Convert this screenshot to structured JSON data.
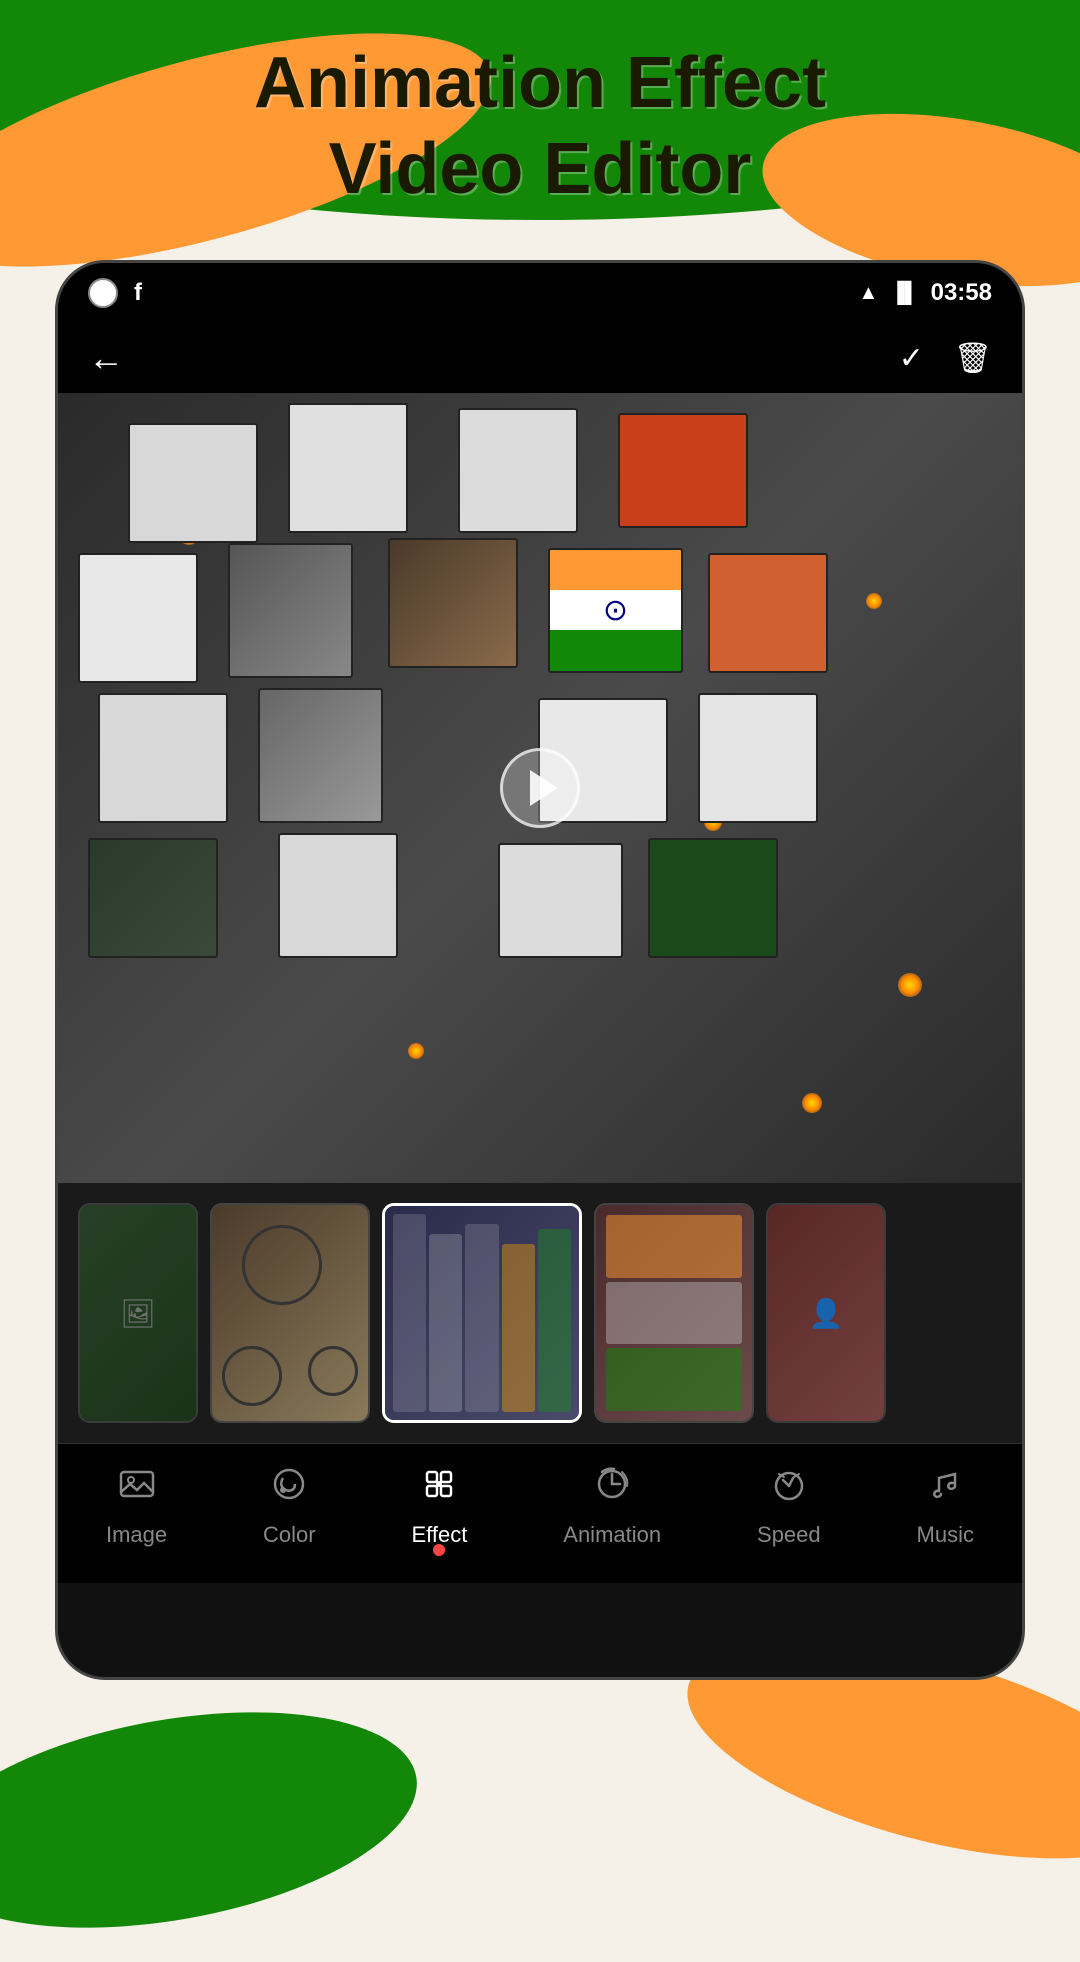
{
  "app": {
    "title_line1": "Animation Effect",
    "title_line2": "Video Editor"
  },
  "status_bar": {
    "time": "03:58",
    "wifi": "WiFi",
    "signal": "Signal"
  },
  "toolbar": {
    "back": "←",
    "check": "✓",
    "delete": "🗑"
  },
  "canvas": {
    "play_button": "Play"
  },
  "bottom_nav": {
    "items": [
      {
        "id": "image",
        "label": "Image",
        "icon": "🖼",
        "active": false
      },
      {
        "id": "color",
        "label": "Color",
        "icon": "🎨",
        "active": false
      },
      {
        "id": "effect",
        "label": "Effect",
        "icon": "✨",
        "active": true
      },
      {
        "id": "animation",
        "label": "Animation",
        "icon": "⏱",
        "active": false
      },
      {
        "id": "speed",
        "label": "Speed",
        "icon": "⚡",
        "active": false
      },
      {
        "id": "music",
        "label": "Music",
        "icon": "🎵",
        "active": false
      }
    ]
  }
}
